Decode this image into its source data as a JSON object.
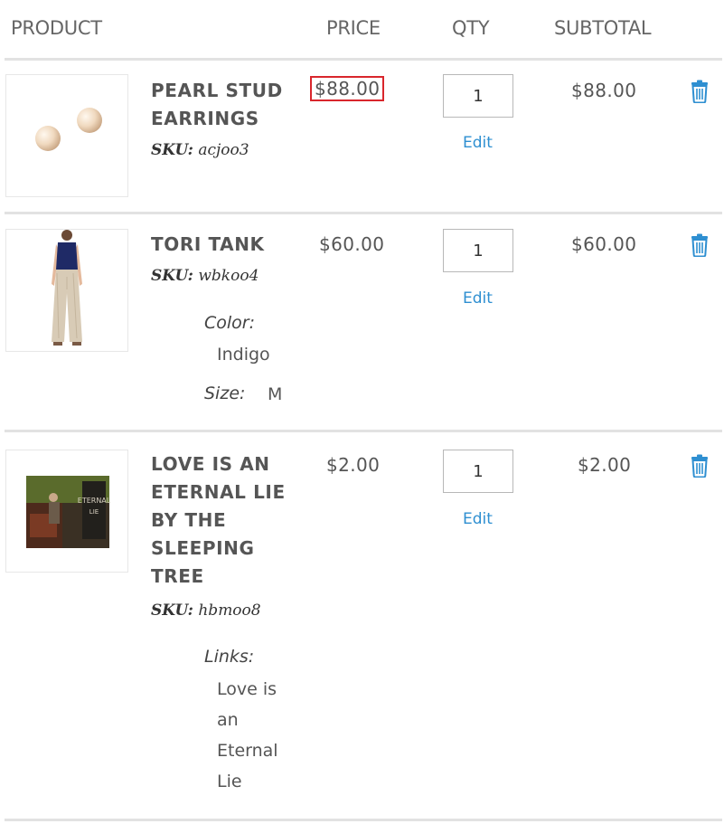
{
  "headers": {
    "product": "PRODUCT",
    "price": "PRICE",
    "qty": "QTY",
    "subtotal": "SUBTOTAL"
  },
  "items": [
    {
      "name_lines": [
        "PEARL STUD",
        "EARRINGS"
      ],
      "sku_label": "SKU:",
      "sku": "acjoo3",
      "price": "$88.00",
      "qty": "1",
      "edit": "Edit",
      "subtotal": "$88.00"
    },
    {
      "name_lines": [
        "TORI TANK"
      ],
      "sku_label": "SKU:",
      "sku": "wbkoo4",
      "options": [
        {
          "label": "Color:",
          "value": "Indigo"
        },
        {
          "label": "Size:",
          "value": "M"
        }
      ],
      "price": "$60.00",
      "qty": "1",
      "edit": "Edit",
      "subtotal": "$60.00"
    },
    {
      "name_lines": [
        "LOVE IS AN",
        "ETERNAL LIE",
        "BY THE",
        "SLEEPING",
        "TREE"
      ],
      "sku_label": "SKU:",
      "sku": "hbmoo8",
      "options": [
        {
          "label": "Links:",
          "value_lines": [
            "Love is",
            "an",
            "Eternal",
            "Lie"
          ]
        }
      ],
      "price": "$2.00",
      "qty": "1",
      "edit": "Edit",
      "subtotal": "$2.00"
    }
  ],
  "colors": {
    "accent": "#2e8fd1",
    "highlight_border": "#d9262c"
  },
  "icons": {
    "remove": "trash-icon"
  }
}
